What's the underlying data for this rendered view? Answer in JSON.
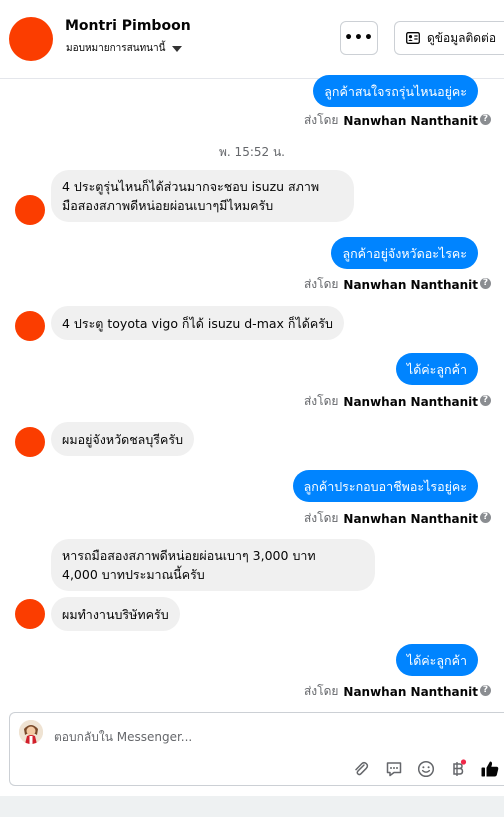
{
  "header": {
    "name": "Montri Pimboon",
    "assign_label": "มอบหมายการสนทนานี้",
    "more_label": "•••",
    "contact_label": "ดูข้อมูลติดต่อ"
  },
  "sent_by_prefix": "ส่งโดย",
  "agent_name": "Nanwhan Nanthanit",
  "help_glyph": "?",
  "timestamp": "พ. 15:52 น.",
  "messages": [
    {
      "dir": "out",
      "text": "ลูกค้าสนใจรถรุ่นไหนอยู่คะ"
    },
    {
      "dir": "in",
      "lines": [
        "4 ประตูรุ่นไหนก็ได้ส่วนมากจะชอบ isuzu สภาพ",
        "มือสองสภาพดีหน่อยผ่อนเบาๆมีไหมครับ"
      ]
    },
    {
      "dir": "out",
      "text": "ลูกค้าอยู่จังหวัดอะไรคะ"
    },
    {
      "dir": "in",
      "text": "4 ประตู toyota vigo ก็ได้ isuzu d-max ก็ได้ครับ"
    },
    {
      "dir": "out",
      "text": "ได้ค่ะลูกค้า"
    },
    {
      "dir": "in",
      "text": "ผมอยู่จังหวัดชลบุรีครับ"
    },
    {
      "dir": "out",
      "text": "ลูกค้าประกอบอาชีพอะไรอยู่คะ"
    },
    {
      "dir": "in",
      "lines": [
        "หารถมือสองสภาพดีหน่อยผ่อนเบาๆ 3,000 บาท",
        "4,000 บาทประมาณนี้ครับ"
      ]
    },
    {
      "dir": "in",
      "text": "ผมทำงานบริษัทครับ"
    },
    {
      "dir": "out",
      "text": "ได้ค่ะลูกค้า"
    }
  ],
  "composer": {
    "placeholder": "ตอบกลับใน Messenger..."
  },
  "colors": {
    "accent": "#0084ff",
    "customer_avatar": "#fb3d00",
    "incoming_bubble": "#f0f0f0"
  }
}
